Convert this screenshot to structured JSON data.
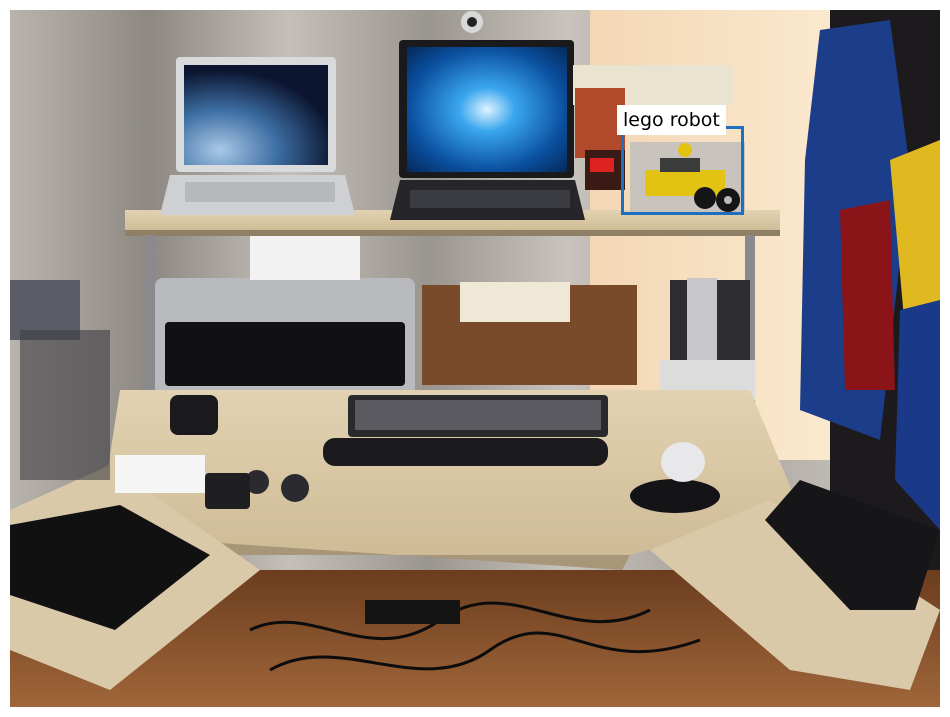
{
  "scene": {
    "description_icon": "desk-setup-photo"
  },
  "annotations": [
    {
      "label": "lego robot",
      "color": "#1f6fc0"
    }
  ],
  "colors": {
    "box": "#1f6fc0",
    "label_bg": "#ffffff",
    "label_text": "#000000"
  }
}
